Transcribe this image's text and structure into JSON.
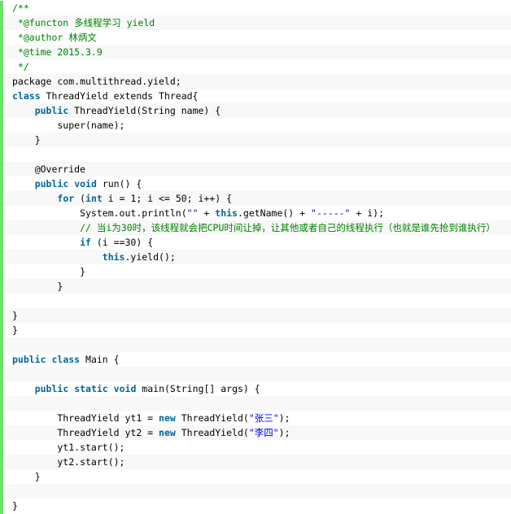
{
  "lines": [
    [
      {
        "t": "/**",
        "c": "comment"
      }
    ],
    [
      {
        "t": " *@functon 多线程学习 yield",
        "c": "comment"
      }
    ],
    [
      {
        "t": " *@author 林炳文",
        "c": "comment"
      }
    ],
    [
      {
        "t": " *@time 2015.3.9",
        "c": "comment"
      }
    ],
    [
      {
        "t": " */",
        "c": "comment"
      }
    ],
    [
      {
        "t": "package com.multithread.yield;",
        "c": "plain"
      }
    ],
    [
      {
        "t": "class",
        "c": "keyword"
      },
      {
        "t": " ThreadYield extends Thread{",
        "c": "plain"
      }
    ],
    [
      {
        "t": "    ",
        "c": "plain"
      },
      {
        "t": "public",
        "c": "keyword"
      },
      {
        "t": " ThreadYield(String name) {",
        "c": "plain"
      }
    ],
    [
      {
        "t": "        super(name);",
        "c": "plain"
      }
    ],
    [
      {
        "t": "    }",
        "c": "plain"
      }
    ],
    [
      {
        "t": "",
        "c": "plain"
      }
    ],
    [
      {
        "t": "    @Override",
        "c": "plain"
      }
    ],
    [
      {
        "t": "    ",
        "c": "plain"
      },
      {
        "t": "public",
        "c": "keyword"
      },
      {
        "t": " ",
        "c": "plain"
      },
      {
        "t": "void",
        "c": "keyword"
      },
      {
        "t": " run() {",
        "c": "plain"
      }
    ],
    [
      {
        "t": "        ",
        "c": "plain"
      },
      {
        "t": "for",
        "c": "keyword"
      },
      {
        "t": " (",
        "c": "plain"
      },
      {
        "t": "int",
        "c": "keyword"
      },
      {
        "t": " i = 1; i <= 50; i++) {",
        "c": "plain"
      }
    ],
    [
      {
        "t": "            System.out.println(",
        "c": "plain"
      },
      {
        "t": "\"\"",
        "c": "string"
      },
      {
        "t": " + ",
        "c": "plain"
      },
      {
        "t": "this",
        "c": "keyword"
      },
      {
        "t": ".getName() + ",
        "c": "plain"
      },
      {
        "t": "\"-----\"",
        "c": "string"
      },
      {
        "t": " + i);",
        "c": "plain"
      }
    ],
    [
      {
        "t": "            ",
        "c": "plain"
      },
      {
        "t": "// 当i为30时，该线程就会把CPU时间让掉，让其他或者自己的线程执行（也就是谁先抢到谁执行）",
        "c": "comment"
      }
    ],
    [
      {
        "t": "            ",
        "c": "plain"
      },
      {
        "t": "if",
        "c": "keyword"
      },
      {
        "t": " (i ==30) {",
        "c": "plain"
      }
    ],
    [
      {
        "t": "                ",
        "c": "plain"
      },
      {
        "t": "this",
        "c": "keyword"
      },
      {
        "t": ".yield();",
        "c": "plain"
      }
    ],
    [
      {
        "t": "            }",
        "c": "plain"
      }
    ],
    [
      {
        "t": "        }",
        "c": "plain"
      }
    ],
    [
      {
        "t": "",
        "c": "plain"
      }
    ],
    [
      {
        "t": "}",
        "c": "plain"
      }
    ],
    [
      {
        "t": "}",
        "c": "plain"
      }
    ],
    [
      {
        "t": "",
        "c": "plain"
      }
    ],
    [
      {
        "t": "public",
        "c": "keyword"
      },
      {
        "t": " ",
        "c": "plain"
      },
      {
        "t": "class",
        "c": "keyword"
      },
      {
        "t": " Main {",
        "c": "plain"
      }
    ],
    [
      {
        "t": "",
        "c": "plain"
      }
    ],
    [
      {
        "t": "    ",
        "c": "plain"
      },
      {
        "t": "public",
        "c": "keyword"
      },
      {
        "t": " ",
        "c": "plain"
      },
      {
        "t": "static",
        "c": "keyword"
      },
      {
        "t": " ",
        "c": "plain"
      },
      {
        "t": "void",
        "c": "keyword"
      },
      {
        "t": " main(String[] args) {",
        "c": "plain"
      }
    ],
    [
      {
        "t": "",
        "c": "plain"
      }
    ],
    [
      {
        "t": "        ThreadYield yt1 = ",
        "c": "plain"
      },
      {
        "t": "new",
        "c": "keyword"
      },
      {
        "t": " ThreadYield(",
        "c": "plain"
      },
      {
        "t": "\"张三\"",
        "c": "string"
      },
      {
        "t": ");",
        "c": "plain"
      }
    ],
    [
      {
        "t": "        ThreadYield yt2 = ",
        "c": "plain"
      },
      {
        "t": "new",
        "c": "keyword"
      },
      {
        "t": " ThreadYield(",
        "c": "plain"
      },
      {
        "t": "\"李四\"",
        "c": "string"
      },
      {
        "t": ");",
        "c": "plain"
      }
    ],
    [
      {
        "t": "        yt1.start();",
        "c": "plain"
      }
    ],
    [
      {
        "t": "        yt2.start();",
        "c": "plain"
      }
    ],
    [
      {
        "t": "    }",
        "c": "plain"
      }
    ],
    [
      {
        "t": "",
        "c": "plain"
      }
    ],
    [
      {
        "t": "}",
        "c": "plain"
      }
    ]
  ]
}
